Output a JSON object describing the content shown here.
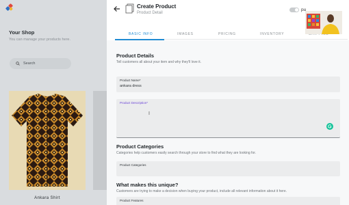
{
  "background": {
    "shop_title": "Your Shop",
    "shop_subtitle": "You can manage your products here.",
    "search_label": "Search",
    "product_name": "Ankara Shirt"
  },
  "modal": {
    "title": "Create Product",
    "subtitle": "Product Detail",
    "publish_label": "pu",
    "tabs": [
      {
        "label": "BASIC INFO",
        "active": true
      },
      {
        "label": "IMAGES",
        "active": false
      },
      {
        "label": "PRICING",
        "active": false
      },
      {
        "label": "INVENTORY",
        "active": false
      },
      {
        "label": "SHIPPING",
        "active": false
      }
    ],
    "details": {
      "title": "Product Details",
      "description": "Tell customers all about your item and why they'll love it.",
      "name_label": "Product Name*",
      "name_value": "ankara dress",
      "desc_label": "Product Description*",
      "desc_value": ""
    },
    "categories": {
      "title": "Product Categories",
      "description": "Categories help customers easily search through your store to find what they are looking for.",
      "field_label": "Product Categories"
    },
    "unique": {
      "title": "What makes this unique?",
      "description": "Customers are trying to make a decision when buying your product, include all relevant information about it here.",
      "field_label": "Product Features"
    }
  },
  "colors": {
    "accent": "#1f8bd3",
    "focus_label": "#6b45d6",
    "grammarly": "#15c39a"
  },
  "icons": [
    "back-arrow-icon",
    "product-doc-icon",
    "search-icon",
    "grammarly-icon",
    "text-cursor-icon"
  ]
}
